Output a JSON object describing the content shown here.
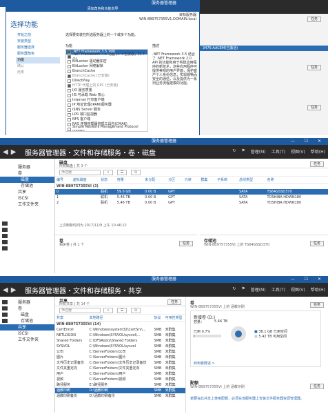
{
  "p1": {
    "window_title": "服务器管理器",
    "wizard_title": "添加角色和功能向导",
    "heading": "选择功能",
    "server_label": "目标服务器",
    "server_name": "WIN-8B9757355V1.DOMAIN.local",
    "nav": [
      "开始之前",
      "安装类型",
      "服务器选择",
      "服务器角色",
      "功能",
      "确认",
      "结果"
    ],
    "description": "选择要安装在所选服务器上的一个或多个功能。",
    "features_caption": "功能",
    "desc_caption": "描述",
    "features": [
      {
        "label": ".NET Framework 3.5 功能",
        "checked": true
      },
      {
        "label": ".NET Framework 4.5 功能 (4 个已安装，共 7 个)",
        "checked": true
      },
      {
        "label": "BitLocker 驱动器加密",
        "checked": false
      },
      {
        "label": "BitLocker 网络解锁",
        "checked": false
      },
      {
        "label": "BranchCache",
        "checked": false
      },
      {
        "label": "BranchCache (已安装)",
        "checked": true
      },
      {
        "label": "DirectPlay",
        "checked": false
      },
      {
        "label": "HTTP 代理上的 RPC (已安装)",
        "checked": true
      },
      {
        "label": "I/O 服务质量",
        "checked": false
      },
      {
        "label": "IIS 可承载 Web 核心",
        "checked": false
      },
      {
        "label": "Internet 打印客户端",
        "checked": false
      },
      {
        "label": "IP 地址管理(IPAM)服务器",
        "checked": false
      },
      {
        "label": "iSNS Server 服务",
        "checked": false
      },
      {
        "label": "LPR 端口监视器",
        "checked": false
      },
      {
        "label": "NFS 客户端",
        "checked": false
      },
      {
        "label": "RAS 连接管理器管理工具包(CMAK)",
        "checked": false
      },
      {
        "label": "Simple Network Management Protocol (SNMP)",
        "checked": false
      }
    ],
    "feature_desc": ".NET Framework 3.5 结合了 .NET Framework 2.0 API 的功能和用于构建应用程序的新技术，这些应用程序可提供美观的用户界面，保护客户个人身份信息，实现顺畅而安全的通信，以及提供为一系列业务流程建模的功能。",
    "right_rows": [
      "任务",
      "任务",
      "任务"
    ],
    "right_server": "3476-AACEM(已激活)"
  },
  "p2": {
    "window_title": "服务器管理器",
    "breadcrumb": "服务器管理器・文件和存储服务・卷・磁盘",
    "tools": [
      "管理(M)",
      "工具(T)",
      "视图(V)",
      "帮助(H)"
    ],
    "sidebar": [
      "服务器",
      "卷",
      "磁盘",
      "存储池",
      "共享",
      "iSCSI",
      "工作文件夹"
    ],
    "section_title": "磁盘",
    "section_sub": "所有磁盘 | 共 3 个",
    "task_label": "任务",
    "filter_placeholder": "筛选器",
    "columns": [
      "编号",
      "虚拟磁盘",
      "状态",
      "容量",
      "未分配",
      "分区",
      "只读",
      "群集",
      "子系统",
      "总线类型",
      "名称"
    ],
    "group": "WIN-8B9757355VI (3)",
    "rows": [
      [
        "0",
        "",
        "联机",
        "59.6 GB",
        "0.00 B",
        "GPT",
        "",
        "",
        "",
        "SATA",
        "TS64GSSD370"
      ],
      [
        "1",
        "",
        "联机",
        "5.46 TB",
        "0.00 B",
        "GPT",
        "",
        "",
        "",
        "SATA",
        "TOSHIBA HDWN180"
      ],
      [
        "2",
        "",
        "联机",
        "5.46 TB",
        "0.00 B",
        "GPT",
        "",
        "",
        "",
        "SATA",
        "TOSHIBA HDWN180"
      ]
    ],
    "refresh": "上次刷新时间为 2017/11/9 上午 10:46:22",
    "vol_title": "卷",
    "vol_sub": "相关卷 | 共 1 个",
    "pool_title": "存储池",
    "pool_sub": "WIN-8B9757355VI 上的 TS64GSSD370"
  },
  "p3": {
    "window_title": "服务器管理器",
    "breadcrumb": "服务器管理器・文件和存储服务・共享",
    "tools": [
      "管理(M)",
      "工具(T)",
      "视图(V)",
      "帮助(H)"
    ],
    "sidebar": [
      "服务器",
      "卷",
      "磁盘",
      "存储池",
      "共享",
      "iSCSI",
      "工作文件夹"
    ],
    "section_title": "共享",
    "section_sub": "所有共享 | 共 14 个",
    "task_label": "任务",
    "filter_placeholder": "筛选器",
    "columns": [
      "共享",
      "本地路径",
      "协议",
      "可用性类型"
    ],
    "group": "WIN-8B9757355VI (14)",
    "rows": [
      [
        "CertEnroll",
        "C:\\Windows\\system32\\CertSrv\\...",
        "SMB",
        "未群集"
      ],
      [
        "NETLOGON",
        "C:\\Windows\\SYSVOL\\sysvol\\...",
        "SMB",
        "未群集"
      ],
      [
        "Shared Folders",
        "C:\\DFSRoots\\Shared Folders",
        "SMB",
        "未群集"
      ],
      [
        "SYSVOL",
        "C:\\Windows\\SYSVOL\\sysvol",
        "SMB",
        "未群集"
      ],
      [
        "公司",
        "C:\\ServerFolders\\公司",
        "SMB",
        "未群集"
      ],
      [
        "图片",
        "C:\\ServerFolders\\图片",
        "SMB",
        "未群集"
      ],
      [
        "文件历史记录备份",
        "C:\\ServerFolders\\文件历史记录备份",
        "SMB",
        "未群集"
      ],
      [
        "文件夹重定向",
        "C:\\ServerFolders\\文件夹重定向",
        "SMB",
        "未群集"
      ],
      [
        "用户",
        "C:\\ServerFolders\\用户",
        "SMB",
        "未群集"
      ],
      [
        "视频",
        "C:\\ServerFolders\\视频",
        "SMB",
        "未群集"
      ],
      [
        "路径服务",
        "E:\\路径服务",
        "SMB",
        "未群集"
      ],
      [
        "涵教印刷",
        "D:\\涵教印刷",
        "SMB",
        "未群集"
      ],
      [
        "涵教印刷备份",
        "D:\\涵教印刷备份",
        "SMB",
        "未群集"
      ]
    ],
    "selected_row": 11,
    "vol_title": "卷",
    "vol_sub": "WIN-8B9757355VI 上的 涵教印刷",
    "vol_name": "新增卷 (D:)",
    "capacity_label": "容量：",
    "capacity": "5.46 TB",
    "used_label": "已用 0.7%",
    "used": "38.1 GB 已用空间",
    "free": "5.42 TB 可用空间",
    "used_fraction": 0.007,
    "link": "转到卷概述 >",
    "quota_title": "配额",
    "quota_sub": "WIN-8B9757355VI 上的 涵教印刷",
    "quota_text": "若要在此共享上使用配额，必须在该服务器上安装文件服务器资源管理器。"
  }
}
